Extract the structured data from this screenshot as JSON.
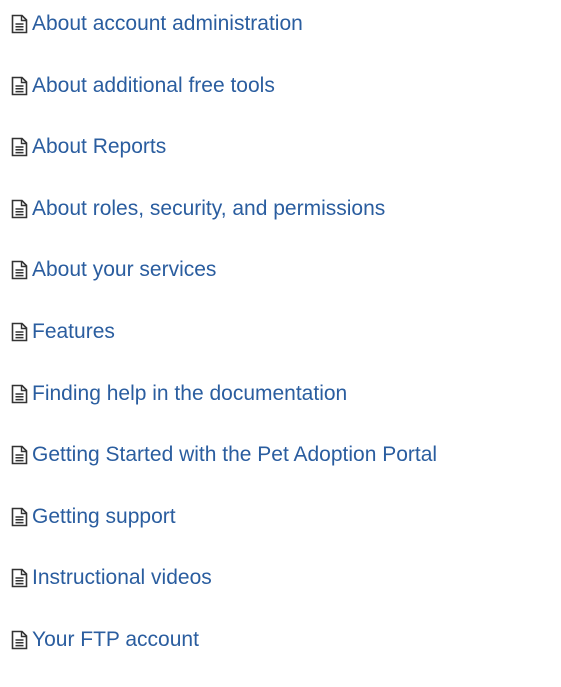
{
  "icon": "document-icon",
  "link_color": "#2a5d9f",
  "icon_color": "#333333",
  "items": [
    {
      "label": "About account administration"
    },
    {
      "label": "About additional free tools"
    },
    {
      "label": "About Reports"
    },
    {
      "label": "About roles, security, and permissions"
    },
    {
      "label": "About your services"
    },
    {
      "label": "Features"
    },
    {
      "label": "Finding help in the documentation"
    },
    {
      "label": "Getting Started with the Pet Adoption Portal"
    },
    {
      "label": "Getting support"
    },
    {
      "label": "Instructional videos"
    },
    {
      "label": "Your FTP account"
    }
  ]
}
